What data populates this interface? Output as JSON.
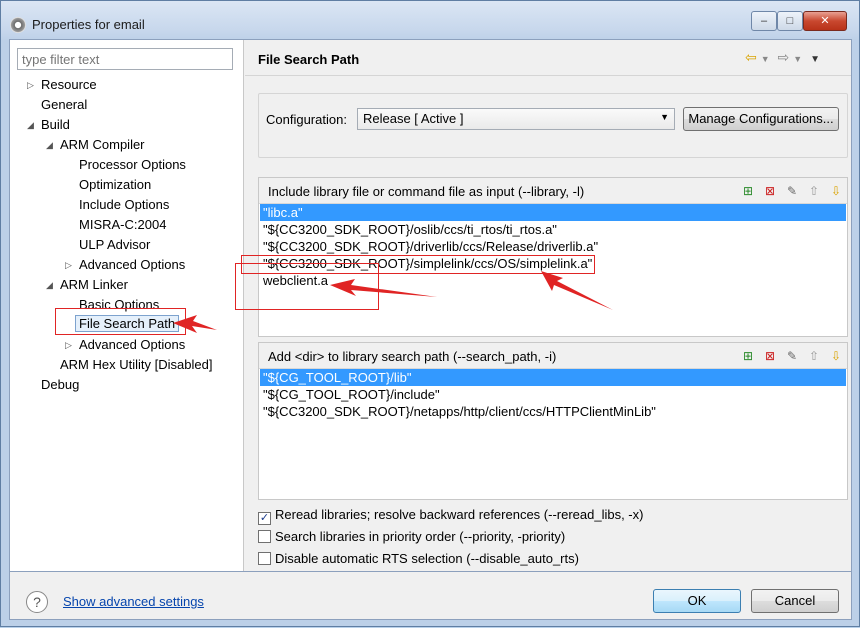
{
  "window": {
    "title": "Properties for email",
    "min": "–",
    "max": "□",
    "close": "✕"
  },
  "filter": {
    "placeholder": "type filter text"
  },
  "tree": {
    "resource": "Resource",
    "general": "General",
    "build": "Build",
    "arm_compiler": "ARM Compiler",
    "processor_options": "Processor Options",
    "optimization": "Optimization",
    "include_options": "Include Options",
    "misra": "MISRA-C:2004",
    "ulp_advisor": "ULP Advisor",
    "compiler_advanced": "Advanced Options",
    "arm_linker": "ARM Linker",
    "basic_options": "Basic Options",
    "file_search_path": "File Search Path",
    "linker_advanced": "Advanced Options",
    "hex_utility": "ARM Hex Utility  [Disabled]",
    "debug": "Debug"
  },
  "page": {
    "title": "File Search Path"
  },
  "configuration": {
    "label": "Configuration:",
    "value": "Release  [ Active ]",
    "manage_label": "Manage Configurations..."
  },
  "library_group": {
    "label": "Include library file or command file as input (--library, -l)",
    "items": [
      "\"libc.a\"",
      "\"${CC3200_SDK_ROOT}/oslib/ccs/ti_rtos/ti_rtos.a\"",
      "\"${CC3200_SDK_ROOT}/driverlib/ccs/Release/driverlib.a\"",
      "\"${CC3200_SDK_ROOT}/simplelink/ccs/OS/simplelink.a\"",
      "webclient.a"
    ]
  },
  "search_path_group": {
    "label": "Add <dir> to library search path (--search_path, -i)",
    "items": [
      "\"${CG_TOOL_ROOT}/lib\"",
      "\"${CG_TOOL_ROOT}/include\"",
      "\"${CC3200_SDK_ROOT}/netapps/http/client/ccs/HTTPClientMinLib\""
    ]
  },
  "options": {
    "reread": {
      "label": "Reread libraries; resolve backward references (--reread_libs, -x)",
      "checked": true
    },
    "priority": {
      "label": "Search libraries in priority order (--priority, -priority)",
      "checked": false
    },
    "disable_rts": {
      "label": "Disable automatic RTS selection (--disable_auto_rts)",
      "checked": false
    }
  },
  "footer": {
    "help": "?",
    "advanced_link": "Show advanced settings",
    "ok": "OK",
    "cancel": "Cancel"
  },
  "colors": {
    "selection": "#3399ff",
    "annotation": "#e02424"
  }
}
